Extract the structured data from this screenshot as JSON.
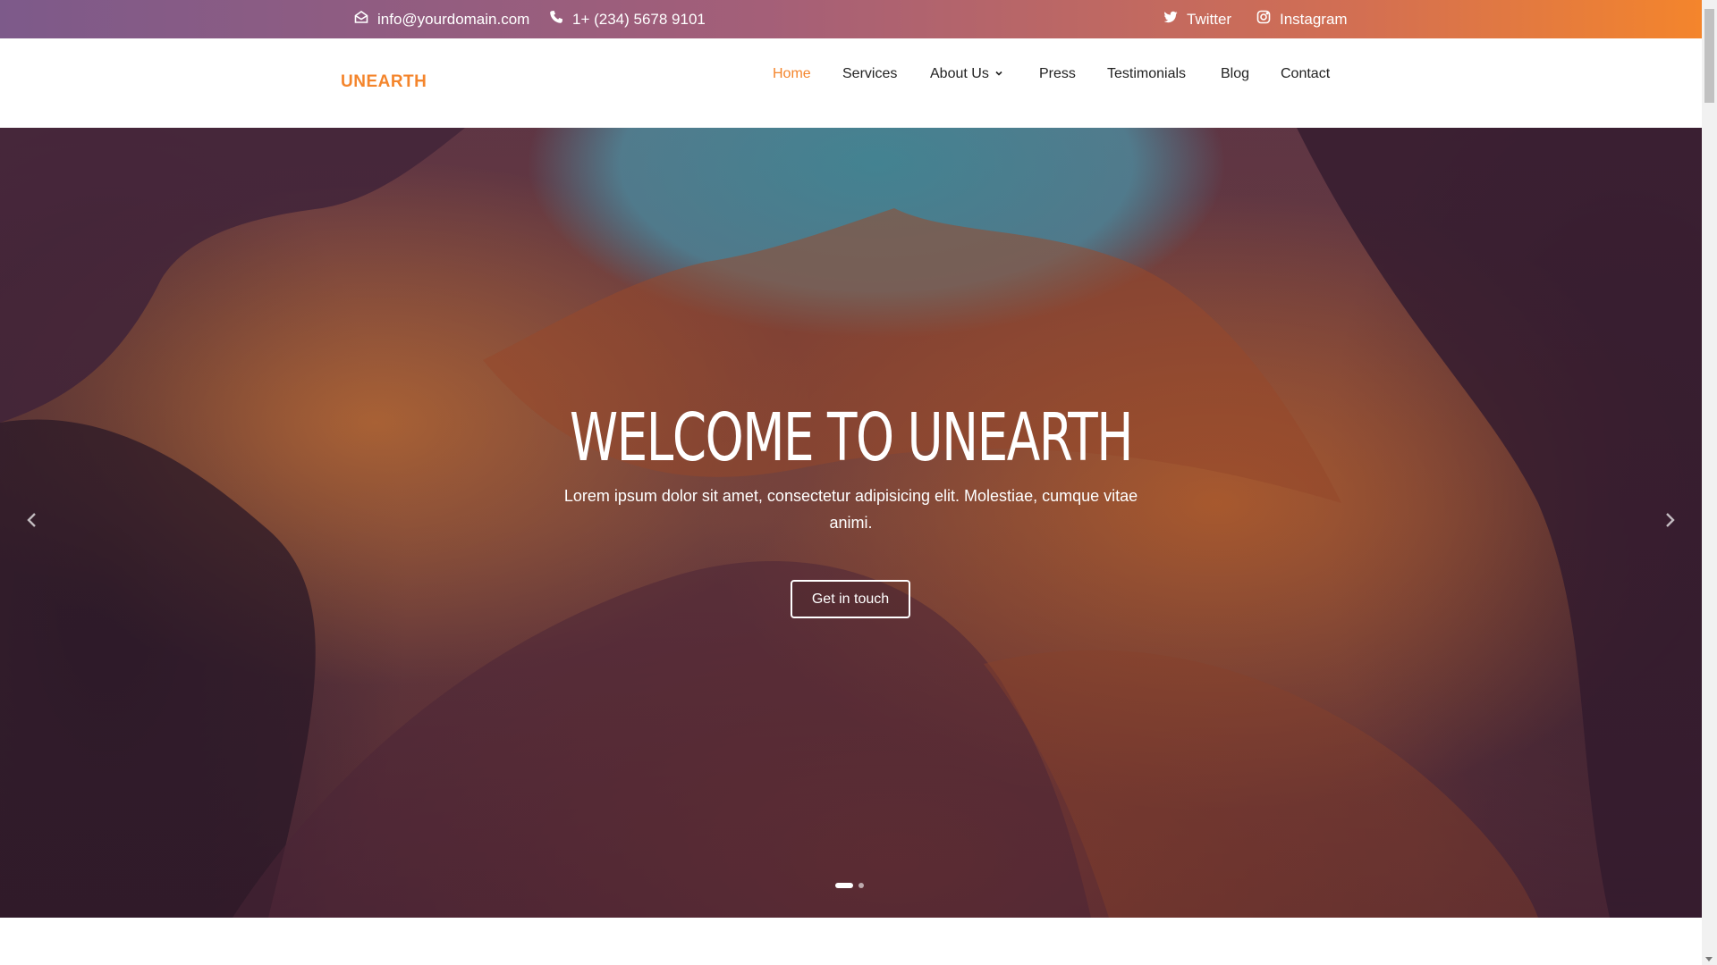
{
  "topbar": {
    "email": "info@yourdomain.com",
    "phone": "1+ (234) 5678 9101",
    "twitter": "Twitter",
    "instagram": "Instagram",
    "icons": [
      "envelope-icon",
      "phone-icon",
      "twitter-icon",
      "instagram-icon"
    ],
    "gradient": [
      "#7d5a8a",
      "#f4852c"
    ]
  },
  "header": {
    "logo": "UNEARTH",
    "nav": [
      {
        "label": "Home",
        "active": true
      },
      {
        "label": "Services"
      },
      {
        "label": "About Us",
        "dropdown": true
      },
      {
        "label": "Press"
      },
      {
        "label": "Testimonials"
      },
      {
        "label": "Blog"
      },
      {
        "label": "Contact"
      }
    ],
    "accent_color": "#f4852c"
  },
  "hero": {
    "title": "WELCOME TO UNEARTH",
    "subtitle": "Lorem ipsum dolor sit amet, consectetur adipisicing elit. Molestiae, cumque vitae animi.",
    "button": "Get in touch",
    "slides": 2,
    "active_slide": 1
  }
}
